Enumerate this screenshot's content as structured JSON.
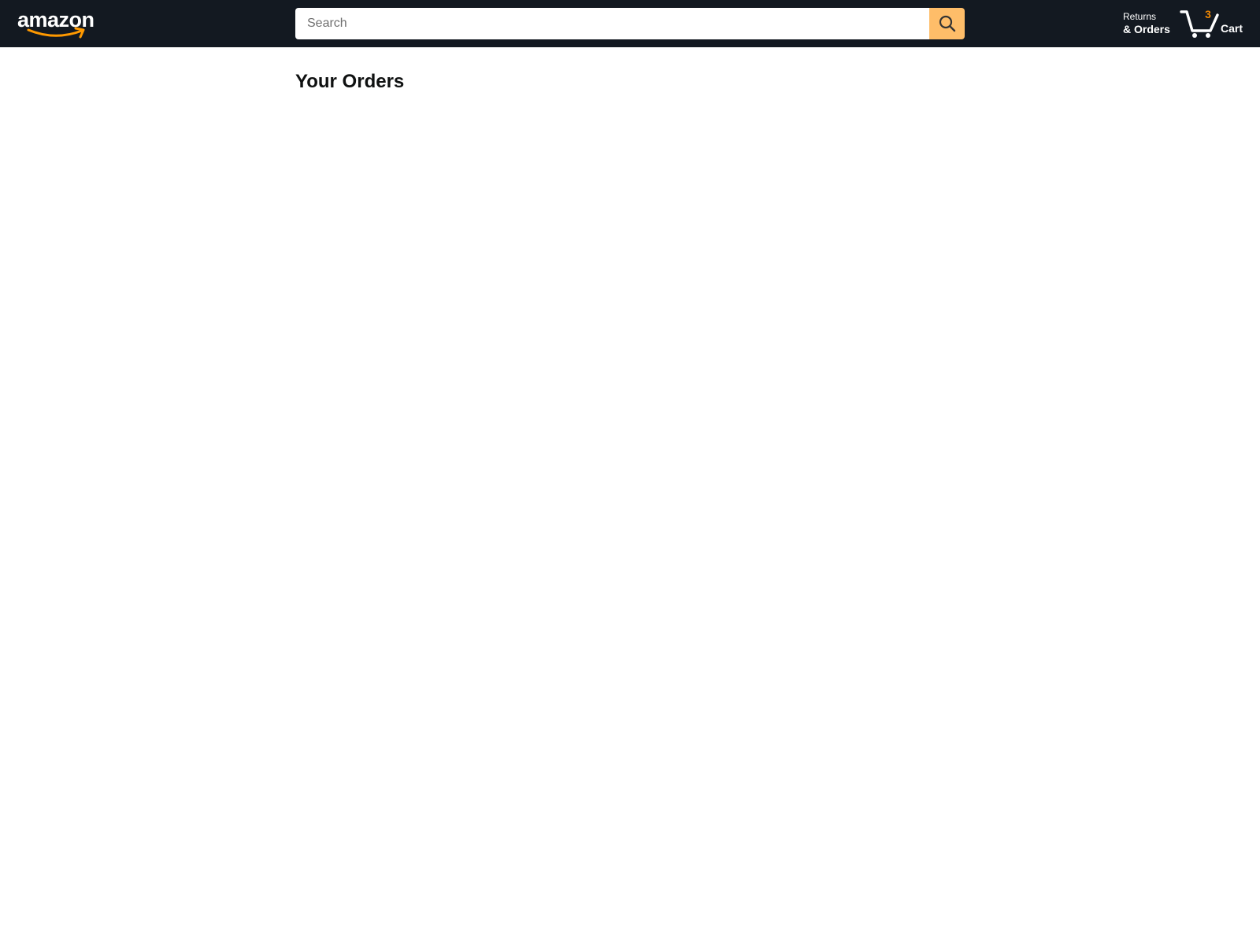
{
  "header": {
    "logo_text": "amazon",
    "search": {
      "placeholder": "Search",
      "value": ""
    },
    "returns": {
      "line1": "Returns",
      "line2": "& Orders"
    },
    "cart": {
      "count": "3",
      "label": "Cart"
    }
  },
  "main": {
    "title": "Your Orders"
  },
  "icons": {
    "search_button": "search-icon",
    "cart": "cart-icon",
    "logo_smile": "smile-arrow-icon"
  },
  "colors": {
    "navbar_bg": "#131921",
    "search_button_bg": "#febd69",
    "cart_count": "#f08804",
    "logo_smile": "#ff9900"
  }
}
